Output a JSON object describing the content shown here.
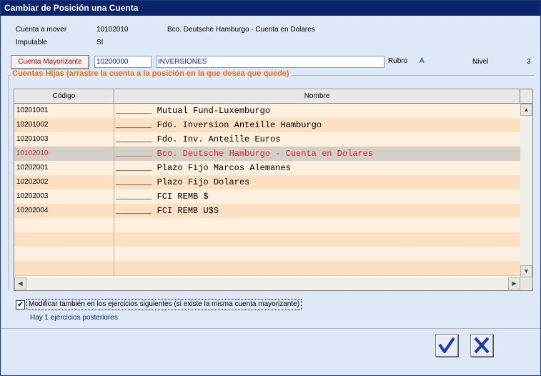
{
  "window": {
    "title": "Cambiar de Posición una Cuenta"
  },
  "info": {
    "cuenta_label": "Cuenta a mover",
    "cuenta_code": "10102010",
    "cuenta_name": "Bco. Deutsche Hamburgo - Cuenta en Dolares",
    "imputable_label": "Imputable",
    "imputable_value": "SI"
  },
  "mayorizante": {
    "button_label": "Cuenta Mayorizante",
    "code": "10200000",
    "name": "INVERSIONES",
    "rubro_label": "Rubro",
    "rubro_value": "A",
    "nivel_label": "Nivel",
    "nivel_value": "3"
  },
  "group": {
    "title": "Cuentas Hijas (arrastre la cuenta a la posición en la que desea que quede)"
  },
  "grid": {
    "columns": [
      "Código",
      "Nombre"
    ],
    "rows": [
      {
        "code": "10201001",
        "prefix": "_______",
        "name": "Mutual Fund-Luxemburgo"
      },
      {
        "code": "10201002",
        "prefix": "_______",
        "name": "Fdo. Inversion Anteille Hamburgo"
      },
      {
        "code": "10201003",
        "prefix": "_______",
        "name": "Fdo. Inv. Anteille Euros"
      },
      {
        "code": "10102010",
        "prefix": "_______",
        "name": "Bco. Deutsche Hamburgo - Cuenta en Dolares"
      },
      {
        "code": "10202001",
        "prefix": "_______",
        "name": "Plazo Fijo Marcos Alemanes"
      },
      {
        "code": "10202002",
        "prefix": "_______",
        "name": "Plazo Fijo Dolares"
      },
      {
        "code": "10202003",
        "prefix": "_______",
        "name": "FCI REMB $"
      },
      {
        "code": "10202004",
        "prefix": "_______",
        "name": "FCI REMB U$S"
      }
    ],
    "selected_code": "10102010"
  },
  "options": {
    "modify_checked": true,
    "modify_label": "Modificar también en los ejercicios siguientes (si existe la misma cuenta mayorizante)",
    "posterior_info": "Hay 1 ejercicios posteriores"
  },
  "colors": {
    "titlebar": "#0a246a",
    "selected_text": "#e0262a",
    "group_title": "#f07010",
    "ok": "#1c3aa8",
    "cancel": "#1c3aa8"
  }
}
